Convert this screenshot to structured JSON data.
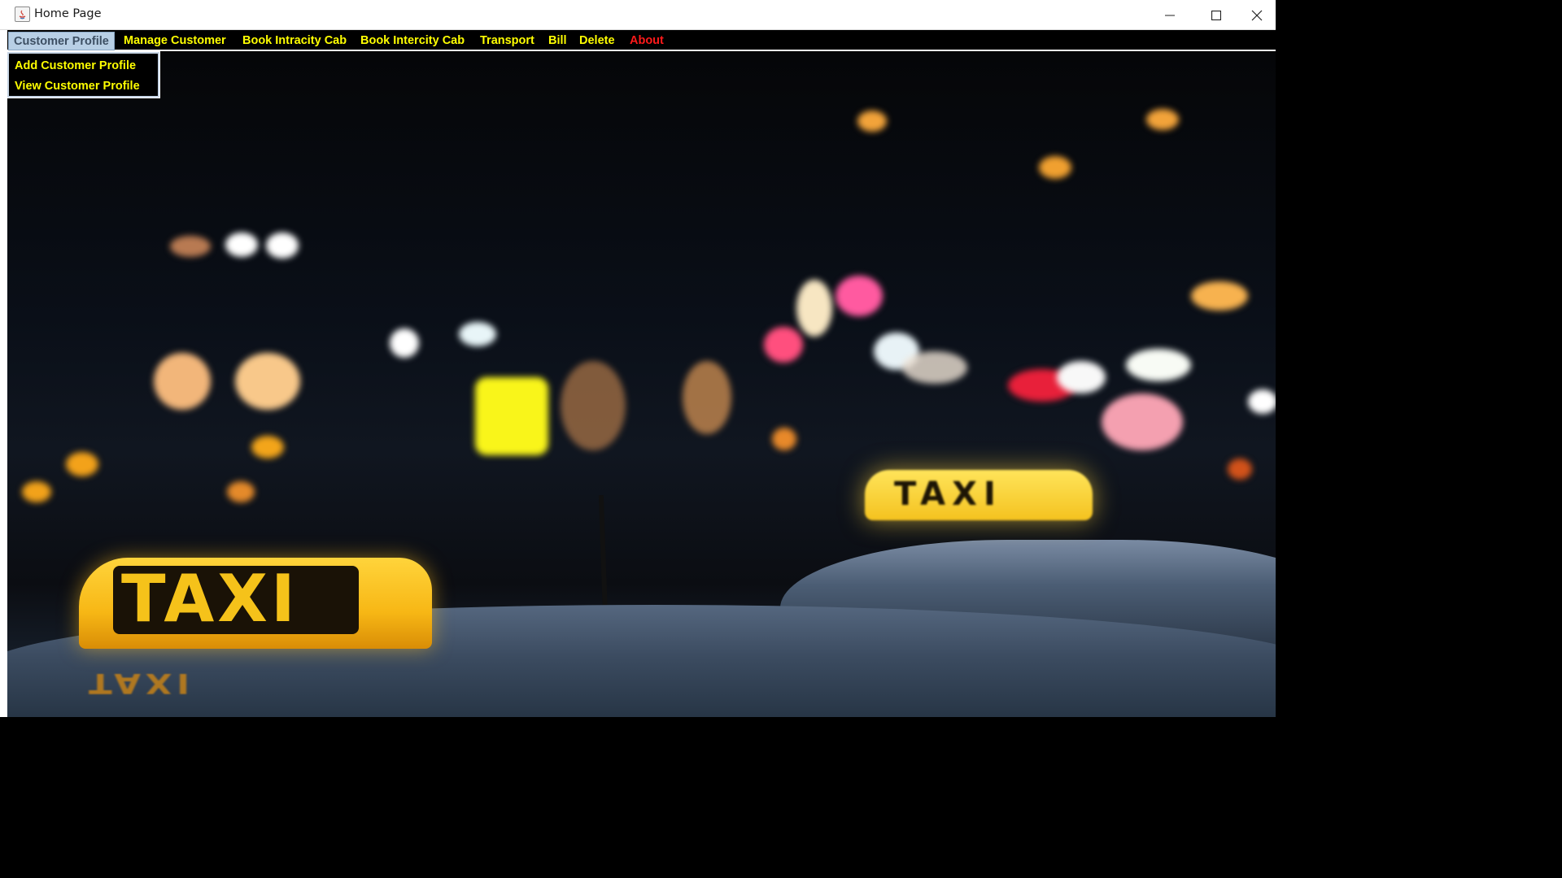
{
  "window": {
    "title": "Home Page",
    "controls": [
      "minimize",
      "maximize",
      "close"
    ]
  },
  "menubar": {
    "items": [
      {
        "label": "Customer Profile",
        "active": true
      },
      {
        "label": "Manage Customer"
      },
      {
        "label": "Book Intracity Cab"
      },
      {
        "label": "Book Intercity Cab"
      },
      {
        "label": "Transport"
      },
      {
        "label": "Bill"
      },
      {
        "label": "Delete"
      },
      {
        "label": "About"
      }
    ]
  },
  "dropdown": {
    "items": [
      {
        "label": "Add Customer Profile"
      },
      {
        "label": "View Customer Profile"
      }
    ]
  },
  "background": {
    "sign_front": "TAXI",
    "sign_back": "TAXI"
  },
  "colors": {
    "menu_text": "#ffff00",
    "about_text": "#ff1a1a",
    "menu_bg": "#000000",
    "active_menu_bg": "#b8cfe5"
  }
}
